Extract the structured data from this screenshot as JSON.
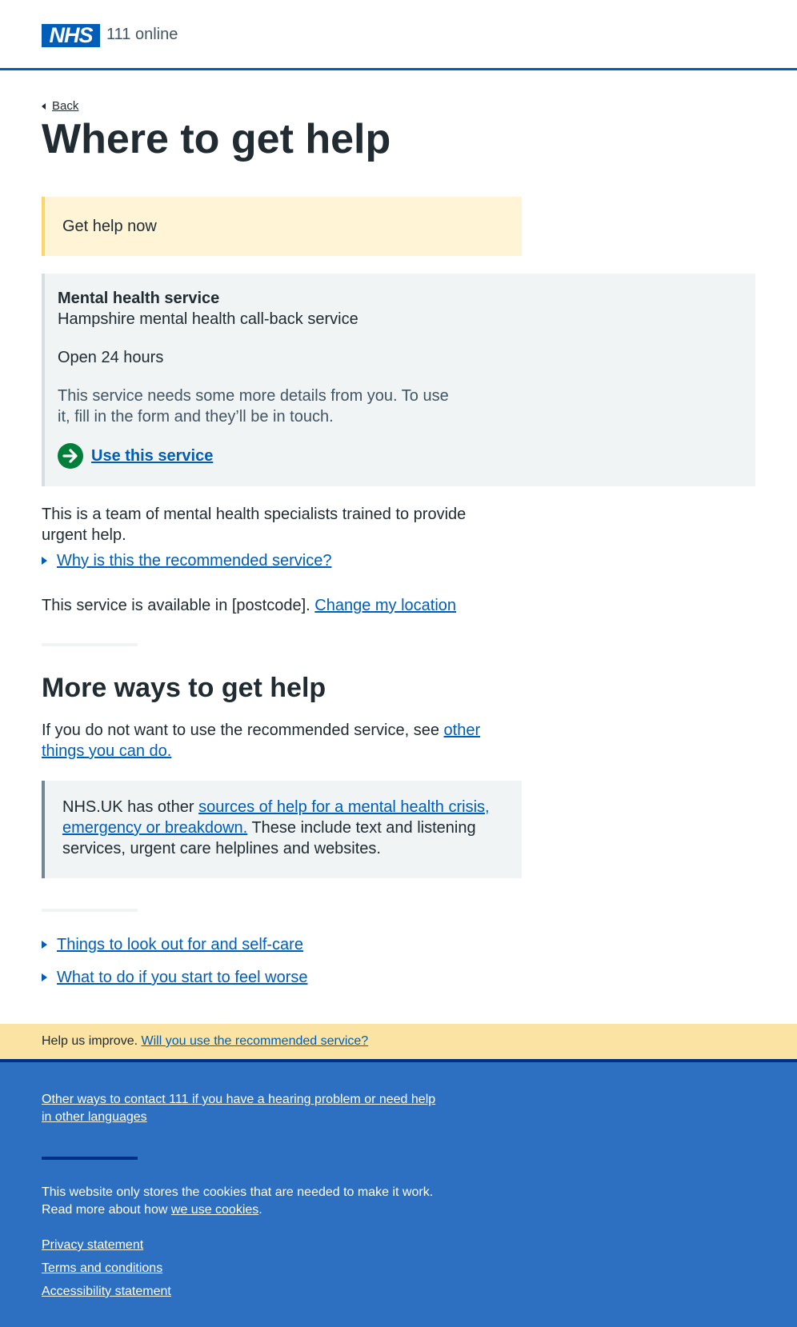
{
  "header": {
    "logo_text": "NHS",
    "service_name": "111 online"
  },
  "back_label": "Back",
  "page_title": "Where to get help",
  "help_now_label": "Get help now",
  "service": {
    "type": "Mental health service",
    "name": "Hampshire mental health call-back service",
    "hours": "Open 24 hours",
    "description": "This service needs some more details from you. To use it, fill in the form and they’ll be in touch.",
    "use_label": "Use this service"
  },
  "team_description": "This is a team of mental health specialists trained to provide urgent help.",
  "why_recommended": "Why is this the recommended service?",
  "availability": {
    "text": "This service is available in [postcode].",
    "change_link": "Change my location"
  },
  "more_ways": {
    "heading": "More ways to get help",
    "intro": "If you do not want to use the recommended service, see",
    "link": "other things you can do."
  },
  "nhsuk": {
    "prefix": "NHS.UK has other",
    "link": "sources of help for a mental health crisis, emergency or breakdown.",
    "suffix": "These include text and listening services, urgent care helplines and websites."
  },
  "expanders": [
    "Things to look out for and self-care",
    "What to do if you start to feel worse"
  ],
  "feedback": {
    "prefix": "Help us improve.",
    "link": "Will you use the recommended service?"
  },
  "footer": {
    "contact_link": "Other ways to contact 111 if you have a hearing problem or need help in other languages",
    "cookies_text": "This website only stores the cookies that are needed to make it work. Read more about how",
    "cookies_link": "we use cookies",
    "cookies_end": ".",
    "links": [
      "Privacy statement",
      "Terms and conditions",
      "Accessibility statement"
    ]
  },
  "colors": {
    "nhs_blue": "#005eb8",
    "green": "#007f3b",
    "footer_blue": "#2d6fc0",
    "feedback_yellow": "#fae3a3"
  }
}
